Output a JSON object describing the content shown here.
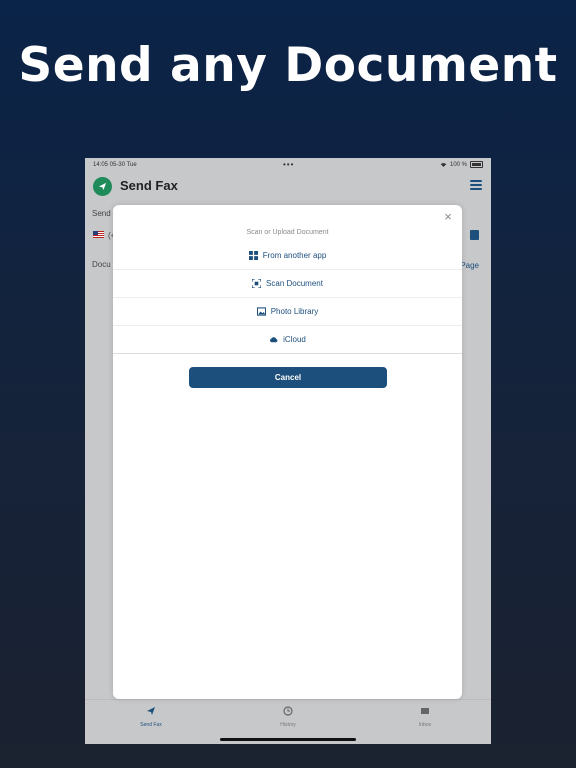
{
  "headline": "Send any Document",
  "status_bar": {
    "time": "14:05  05-30 Tue",
    "dots": "•••",
    "battery": "100 %"
  },
  "app": {
    "title": "Send Fax",
    "send_label": "Send",
    "phone_prefix": "(+",
    "document_label": "Docu",
    "page_label": "Page"
  },
  "modal": {
    "title": "Scan or Upload Document",
    "options": [
      {
        "label": "From another app",
        "icon": "grid-icon"
      },
      {
        "label": "Scan Document",
        "icon": "scan-icon"
      },
      {
        "label": "Photo Library",
        "icon": "photo-icon"
      },
      {
        "label": "iCloud",
        "icon": "cloud-icon"
      }
    ],
    "cancel_label": "Cancel"
  },
  "tabs": [
    {
      "label": "Send Fax",
      "icon": "paper-plane-icon",
      "active": true
    },
    {
      "label": "History",
      "icon": "clock-icon",
      "active": false
    },
    {
      "label": "Inbox",
      "icon": "inbox-icon",
      "active": false
    }
  ],
  "colors": {
    "accent": "#1d4f7c",
    "logo_green": "#1f8a5a"
  }
}
